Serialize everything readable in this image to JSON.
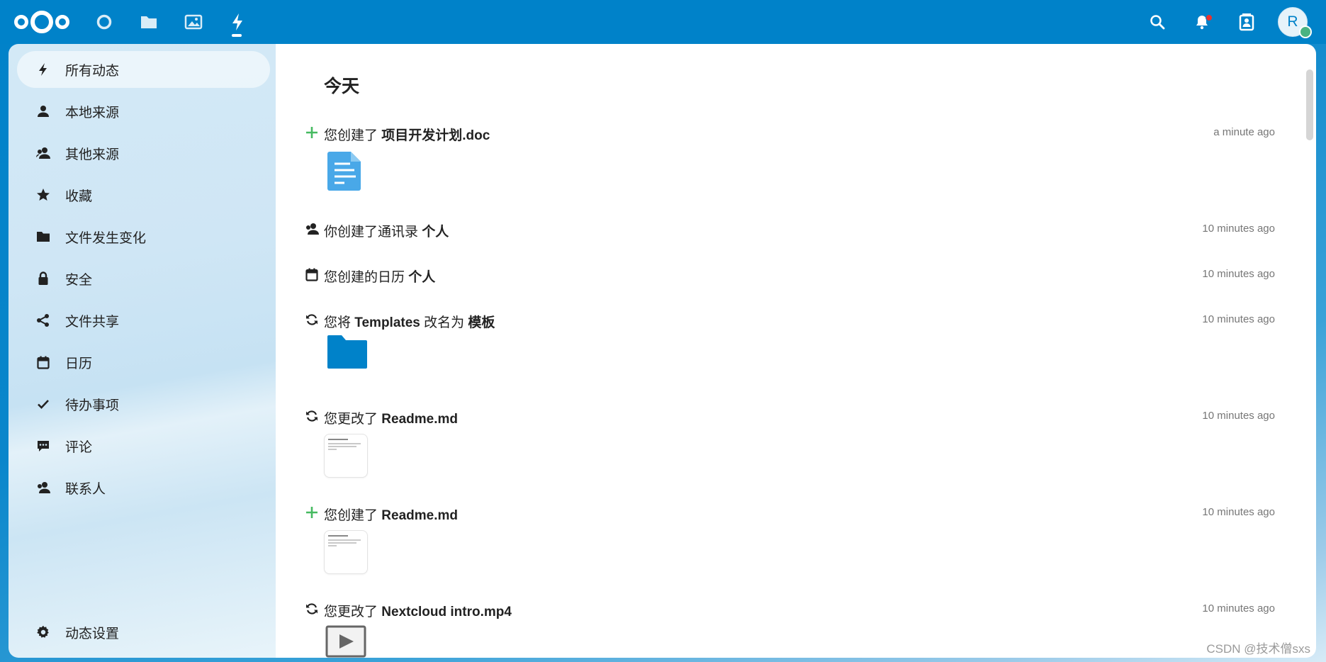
{
  "header": {
    "apps": [
      {
        "name": "dashboard",
        "icon": "circle-icon"
      },
      {
        "name": "files",
        "icon": "folder-icon"
      },
      {
        "name": "photos",
        "icon": "image-icon"
      },
      {
        "name": "activity",
        "icon": "lightning-icon",
        "active": true
      }
    ],
    "right_icons": [
      "search-icon",
      "bell-icon",
      "contacts-icon"
    ],
    "avatar_initial": "R",
    "colors": {
      "brand": "#0082c9",
      "status": "#49b382"
    }
  },
  "sidebar": {
    "items": [
      {
        "label": "所有动态",
        "icon": "lightning-icon",
        "active": true
      },
      {
        "label": "本地来源",
        "icon": "person-icon"
      },
      {
        "label": "其他来源",
        "icon": "people-icon"
      },
      {
        "label": "收藏",
        "icon": "star-icon"
      },
      {
        "label": "文件发生变化",
        "icon": "folder-icon"
      },
      {
        "label": "安全",
        "icon": "lock-icon"
      },
      {
        "label": "文件共享",
        "icon": "share-icon"
      },
      {
        "label": "日历",
        "icon": "calendar-icon"
      },
      {
        "label": "待办事项",
        "icon": "check-icon"
      },
      {
        "label": "评论",
        "icon": "comment-icon"
      },
      {
        "label": "联系人",
        "icon": "people-icon"
      }
    ],
    "settings_label": "动态设置"
  },
  "main": {
    "day_heading": "今天",
    "activities": [
      {
        "icon": "plus-icon",
        "prefix": "您创建了 ",
        "object": "项目开发计划.doc",
        "suffix": "",
        "time": "a minute ago",
        "preview": "document-icon"
      },
      {
        "icon": "people-icon",
        "prefix": "你创建了通讯录 ",
        "object": "个人",
        "suffix": "",
        "time": "10 minutes ago"
      },
      {
        "icon": "calendar-icon",
        "prefix": "您创建的日历 ",
        "object": "个人",
        "suffix": "",
        "time": "10 minutes ago"
      },
      {
        "icon": "sync-icon",
        "prefix": "您将 ",
        "object": "Templates",
        "suffix": " 改名为 ",
        "object2": "模板",
        "time": "10 minutes ago",
        "preview": "folder-icon"
      },
      {
        "icon": "sync-icon",
        "prefix": "您更改了 ",
        "object": "Readme.md",
        "suffix": "",
        "time": "10 minutes ago",
        "preview": "markdown-thumbnail"
      },
      {
        "icon": "plus-icon",
        "prefix": "您创建了 ",
        "object": "Readme.md",
        "suffix": "",
        "time": "10 minutes ago",
        "preview": "markdown-thumbnail"
      },
      {
        "icon": "sync-icon",
        "prefix": "您更改了 ",
        "object": "Nextcloud intro.mp4",
        "suffix": "",
        "time": "10 minutes ago",
        "preview": "video-icon"
      }
    ]
  },
  "watermark": "CSDN @技术僧sxs"
}
